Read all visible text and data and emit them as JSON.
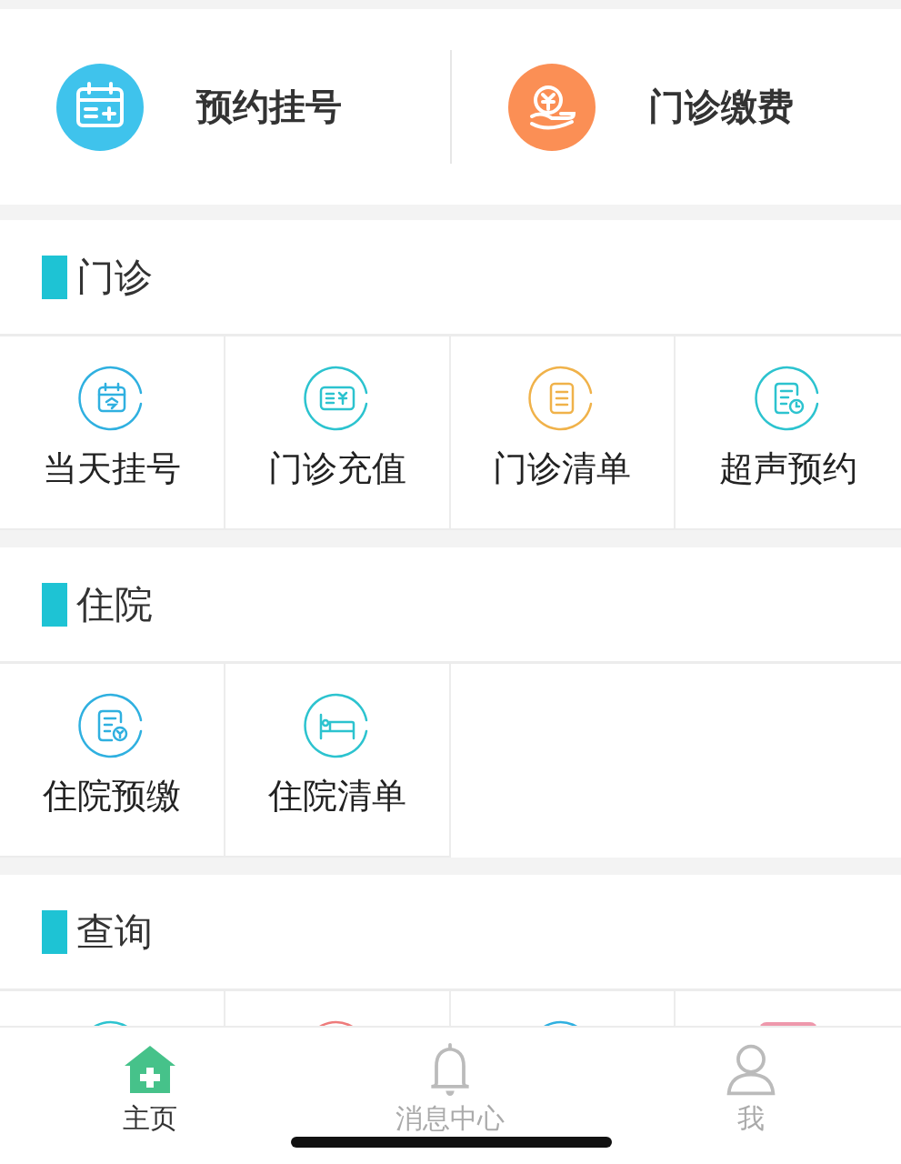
{
  "shortcuts": [
    {
      "label": "预约挂号",
      "kind": "calendar-plus"
    },
    {
      "label": "门诊缴费",
      "kind": "coin-hand"
    }
  ],
  "sections": [
    {
      "title": "门诊",
      "items": [
        {
          "label": "当天挂号",
          "kind": "calendar"
        },
        {
          "label": "门诊充值",
          "kind": "card"
        },
        {
          "label": "门诊清单",
          "kind": "list"
        },
        {
          "label": "超声预约",
          "kind": "doc-clock"
        }
      ]
    },
    {
      "title": "住院",
      "items": [
        {
          "label": "住院预缴",
          "kind": "doc-coin"
        },
        {
          "label": "住院清单",
          "kind": "bed"
        }
      ]
    },
    {
      "title": "查询",
      "items": [
        {
          "kind": "teal-ring"
        },
        {
          "kind": "red-ring"
        },
        {
          "kind": "blue-ring"
        },
        {
          "kind": "pink-tag"
        }
      ]
    }
  ],
  "tab_bar": [
    {
      "label": "主页",
      "kind": "home",
      "selected": true
    },
    {
      "label": "消息中心",
      "kind": "bell",
      "selected": false
    },
    {
      "label": "我",
      "kind": "person",
      "selected": false
    }
  ]
}
